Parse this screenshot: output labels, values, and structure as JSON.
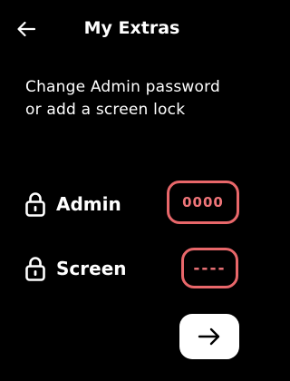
{
  "header": {
    "title": "My Extras",
    "back_icon": "arrow-left-icon"
  },
  "description": "Change Admin password or add a screen lock",
  "rows": [
    {
      "label": "Admin",
      "icon": "lock-icon",
      "value": "0000"
    },
    {
      "label": "Screen",
      "icon": "lock-icon",
      "value": "----"
    }
  ],
  "next_button": {
    "icon": "arrow-right-icon"
  },
  "colors": {
    "background": "#000000",
    "text": "#ffffff",
    "accent": "#e8676a",
    "button": "#ffffff"
  }
}
